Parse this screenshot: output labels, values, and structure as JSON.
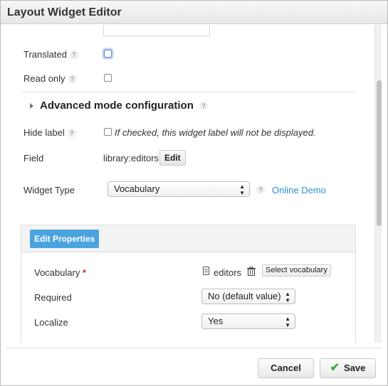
{
  "dialog": {
    "title": "Layout Widget Editor"
  },
  "form": {
    "translated_label": "Translated",
    "readonly_label": "Read only",
    "advanced_title": "Advanced mode configuration",
    "hide_label": "Hide label",
    "hide_label_hint": "If checked, this widget label will not be displayed.",
    "field_label": "Field",
    "field_value": "library:editors",
    "field_edit_button": "Edit",
    "widget_type_label": "Widget Type",
    "widget_type_value": "Vocabulary",
    "online_demo_link": "Online Demo",
    "help_glyph": "?"
  },
  "properties": {
    "button": "Edit Properties",
    "vocabulary_label": "Vocabulary",
    "required_marker": "*",
    "vocabulary_value": "editors",
    "select_vocabulary_button": "Select vocabulary",
    "required_label": "Required",
    "required_value": "No (default value)",
    "localize_label": "Localize",
    "localize_value": "Yes",
    "select_arrows": "▲\n▼"
  },
  "footer": {
    "cancel": "Cancel",
    "save": "Save",
    "save_icon": "✔"
  },
  "colors": {
    "accent": "#4aa3df",
    "link": "#2a8fd6",
    "required": "#d2232a",
    "save_check": "#3aa83a"
  },
  "icons": [
    "help-icon",
    "disclosure-triangle-icon",
    "document-icon",
    "trash-icon",
    "checkmark-icon",
    "select-arrows-icon"
  ]
}
